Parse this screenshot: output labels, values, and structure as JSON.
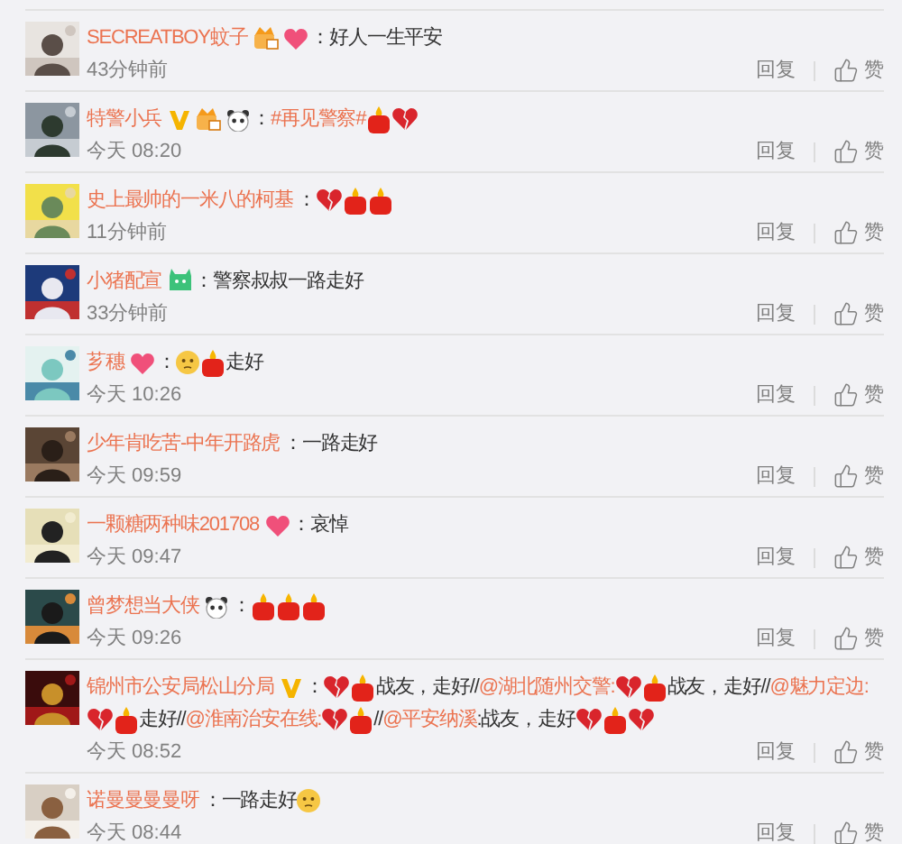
{
  "comments": [
    {
      "avatar": {
        "kind": "picture"
      },
      "name": "SECREATBOY蚊子",
      "badges": [
        {
          "kind": "fan"
        },
        {
          "kind": "heart"
        }
      ],
      "content": [
        {
          "kind": "text",
          "text": "：好人一生平安"
        }
      ],
      "time": "43分钟前",
      "reply": "回复",
      "like": "赞"
    },
    {
      "avatar": {
        "kind": "picture"
      },
      "name": "特警小兵",
      "badges": [
        {
          "kind": "verified"
        },
        {
          "kind": "fan"
        },
        {
          "kind": "panda"
        }
      ],
      "content": [
        {
          "kind": "text",
          "text": "："
        },
        {
          "kind": "link",
          "text": "#再见警察#"
        },
        {
          "kind": "candle"
        },
        {
          "kind": "broken-heart"
        }
      ],
      "time": "今天 08:20",
      "reply": "回复",
      "like": "赞"
    },
    {
      "avatar": {
        "kind": "picture"
      },
      "name": "史上最帅的一米八的柯基",
      "content": [
        {
          "kind": "text",
          "text": "："
        },
        {
          "kind": "broken-heart"
        },
        {
          "kind": "candle"
        },
        {
          "kind": "candle"
        }
      ],
      "time": "11分钟前",
      "reply": "回复",
      "like": "赞"
    },
    {
      "avatar": {
        "kind": "picture"
      },
      "name": "小猪配宣",
      "badges": [
        {
          "kind": "member"
        }
      ],
      "content": [
        {
          "kind": "text",
          "text": "：警察叔叔一路走好"
        }
      ],
      "time": "33分钟前",
      "reply": "回复",
      "like": "赞"
    },
    {
      "avatar": {
        "kind": "picture"
      },
      "name": "芗穗",
      "badges": [
        {
          "kind": "heart"
        }
      ],
      "content": [
        {
          "kind": "text",
          "text": "："
        },
        {
          "kind": "face"
        },
        {
          "kind": "candle"
        },
        {
          "kind": "text",
          "text": "走好"
        }
      ],
      "time": "今天 10:26",
      "reply": "回复",
      "like": "赞"
    },
    {
      "avatar": {
        "kind": "picture"
      },
      "name": "少年肯吃苦-中年开路虎",
      "content": [
        {
          "kind": "text",
          "text": "：一路走好"
        }
      ],
      "time": "今天 09:59",
      "reply": "回复",
      "like": "赞"
    },
    {
      "avatar": {
        "kind": "picture"
      },
      "name": "一颗糖两种味201708",
      "badges": [
        {
          "kind": "heart"
        }
      ],
      "content": [
        {
          "kind": "text",
          "text": "：哀悼"
        }
      ],
      "time": "今天 09:47",
      "reply": "回复",
      "like": "赞"
    },
    {
      "avatar": {
        "kind": "picture"
      },
      "name": "曾梦想当大侠",
      "badges": [
        {
          "kind": "panda"
        }
      ],
      "content": [
        {
          "kind": "text",
          "text": "："
        },
        {
          "kind": "candle"
        },
        {
          "kind": "candle"
        },
        {
          "kind": "candle"
        }
      ],
      "time": "今天 09:26",
      "reply": "回复",
      "like": "赞"
    },
    {
      "avatar": {
        "kind": "picture"
      },
      "name": "锦州市公安局松山分局",
      "badges": [
        {
          "kind": "verified"
        }
      ],
      "content": [
        {
          "kind": "text",
          "text": "："
        },
        {
          "kind": "broken-heart"
        },
        {
          "kind": "candle"
        },
        {
          "kind": "text",
          "text": "战友，走好//"
        },
        {
          "kind": "link",
          "text": "@湖北随州交警:"
        },
        {
          "kind": "broken-heart"
        },
        {
          "kind": "candle"
        },
        {
          "kind": "text",
          "text": "战友，走好//"
        },
        {
          "kind": "link",
          "text": "@魅力定边:"
        },
        {
          "kind": "broken-heart"
        },
        {
          "kind": "candle"
        },
        {
          "kind": "text",
          "text": "走好//"
        },
        {
          "kind": "link",
          "text": "@淮南治安在线:"
        },
        {
          "kind": "broken-heart"
        },
        {
          "kind": "candle"
        },
        {
          "kind": "text",
          "text": "//"
        },
        {
          "kind": "link",
          "text": "@平安纳溪"
        },
        {
          "kind": "text",
          "text": ":战友，走好"
        },
        {
          "kind": "broken-heart"
        },
        {
          "kind": "candle"
        },
        {
          "kind": "broken-heart"
        }
      ],
      "time": "今天 08:52",
      "reply": "回复",
      "like": "赞"
    },
    {
      "avatar": {
        "kind": "picture"
      },
      "name": "诺曼曼曼曼呀",
      "content": [
        {
          "kind": "text",
          "text": "：一路走好"
        },
        {
          "kind": "face"
        }
      ],
      "time": "今天 08:44",
      "reply": "回复",
      "like": "赞"
    }
  ]
}
